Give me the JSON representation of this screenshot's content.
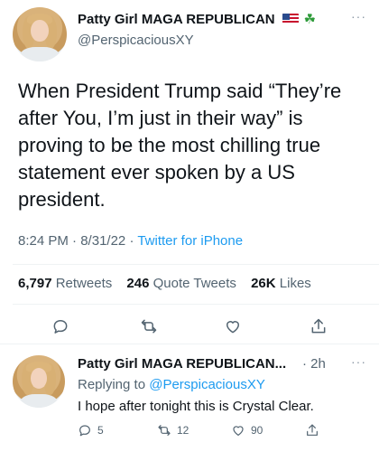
{
  "main_tweet": {
    "author_name": "Patty Girl MAGA REPUBLICAN",
    "handle": "@PerspicaciousXY",
    "text": "When President Trump said “They’re after You, I’m just in their way” is proving to be the most chilling true statement ever spoken by a US president.",
    "time": "8:24 PM",
    "date": "8/31/22",
    "separator": "·",
    "source": "Twitter for iPhone",
    "more": "···"
  },
  "stats": {
    "retweets_count": "6,797",
    "retweets_label": "Retweets",
    "quotes_count": "246",
    "quotes_label": "Quote Tweets",
    "likes_count": "26K",
    "likes_label": "Likes"
  },
  "reply": {
    "author_name": "Patty Girl MAGA REPUBLICAN...",
    "time": "· 2h",
    "replying_prefix": "Replying to",
    "replying_to": "@PerspicaciousXY",
    "text": "I hope after tonight this is Crystal Clear.",
    "reply_count": "5",
    "retweet_count": "12",
    "like_count": "90",
    "more": "···"
  },
  "icons": {
    "emoji_1": "us-flag-icon",
    "emoji_2": "shamrock-icon",
    "clover_glyph": "☘"
  },
  "colors": {
    "link": "#1d9bf0",
    "secondary_text": "#536471",
    "primary_text": "#0f1419"
  }
}
